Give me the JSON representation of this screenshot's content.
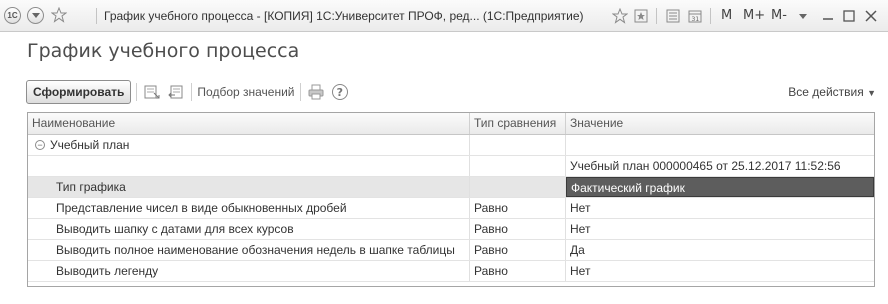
{
  "window": {
    "title": "График учебного процесса - [КОПИЯ] 1С:Университет ПРОФ, ред... (1С:Предприятие)",
    "buttons": {
      "m": "M",
      "m_plus": "M+",
      "m_minus": "M-"
    }
  },
  "form": {
    "title": "График учебного процесса"
  },
  "toolbar": {
    "generate": "Сформировать",
    "pick_values": "Подбор значений",
    "all_actions": "Все действия"
  },
  "table": {
    "columns": {
      "name": "Наименование",
      "compare": "Тип сравнения",
      "value": "Значение"
    },
    "rows": [
      {
        "name": "Учебный план",
        "compare": "",
        "value": ""
      },
      {
        "name": "",
        "compare": "",
        "value": "Учебный план 000000465 от 25.12.2017 11:52:56"
      },
      {
        "name": "Тип графика",
        "compare": "",
        "value": "Фактический график"
      },
      {
        "name": "Представление чисел в виде обыкновенных дробей",
        "compare": "Равно",
        "value": "Нет"
      },
      {
        "name": "Выводить шапку с датами для всех курсов",
        "compare": "Равно",
        "value": "Нет"
      },
      {
        "name": "Выводить полное наименование обозначения недель в шапке таблицы",
        "compare": "Равно",
        "value": "Да"
      },
      {
        "name": "Выводить легенду",
        "compare": "Равно",
        "value": "Нет"
      }
    ]
  }
}
